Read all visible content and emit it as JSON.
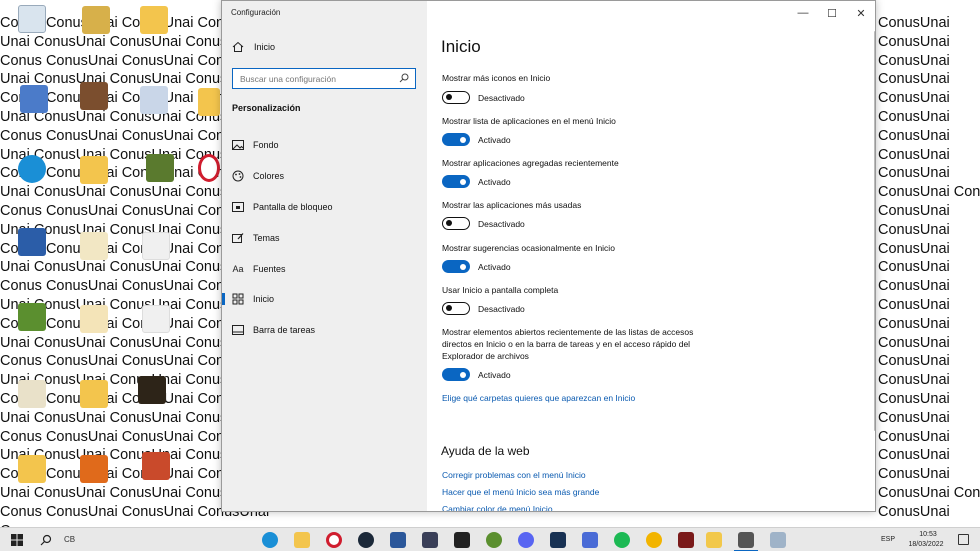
{
  "desktop": {
    "wallpaper_lines": [
      "Conus ConusUnai ConusUnai ConusUnai",
      "Unai ConusUnai ConusUnai ConusUnai",
      "Conus ConusUnai ConusUnai ConusUnai",
      "Unai ConusUnai ConusUnai ConusUnai",
      "Conus ConusUnai ConusUnai ConusUnai",
      "Unai ConusUnai ConusUnai ConusUnai",
      "Conus ConusUnai ConusUnai ConusUnai",
      "Unai ConusUnai ConusUnai ConusUnai",
      "Conus ConusUnai ConusUnai ConusUnai",
      "Unai ConusUnai ConusUnai ConusUnai",
      "Conus ConusUnai ConusUnai ConusUna",
      "Unai ConusUnai ConusUnai ConusUnai",
      "Conus ConusUnai ConusUnai ConusUnai",
      "Unai ConusUnai ConusUnai ConusUnai",
      "Conus ConusUnai ConusUnai ConusUnai",
      "Unai ConusUnai ConusUnai ConusUnai",
      "Conus ConusUnai ConusUnai ConusUnai",
      "Unai ConusUnai ConusUnai ConusUnai",
      "Conus ConusUnai ConusUnai ConusUnai",
      "Unai ConusUnai ConusUnai ConusUnai",
      "Conus ConusUnai ConusUnai ConusUnai",
      "Unai ConusUnai ConusUnai ConusUnai",
      "Conus ConusUnai ConusUnai ConusUnai",
      "Unai ConusUnai ConusUnai ConusUnai",
      "Conus ConusUnai ConusUnai ConusUnai",
      "Unai ConusUnai ConusUnai ConusUnai",
      "Conus ConusUnai ConusUnai ConusUnai",
      "Conus"
    ],
    "wallpaper_right_lines": [
      "ConusUnai",
      "ConusUnai",
      "ConusUnai",
      "ConusUnai",
      "ConusUnai",
      "ConusUnai",
      "ConusUnai",
      "ConusUnai",
      "ConusUnai",
      "ConusUnai Conus",
      "ConusUnai",
      "ConusUnai",
      "ConusUnai",
      "ConusUnai",
      "ConusUnai",
      "ConusUnai",
      "ConusUnai",
      "ConusUnai",
      "ConusUnai",
      "ConusUnai",
      "ConusUnai",
      "ConusUnai",
      "ConusUnai",
      "ConusUnai",
      "ConusUnai",
      "ConusUnai Conus",
      "ConusUnai"
    ]
  },
  "window": {
    "title": "Configuración",
    "controls": {
      "minimize": "—",
      "maximize": "☐",
      "close": "✕"
    }
  },
  "sidebar": {
    "home_label": "Inicio",
    "search_placeholder": "Buscar una configuración",
    "section_title": "Personalización",
    "items": [
      {
        "label": "Fondo",
        "icon": "image-icon"
      },
      {
        "label": "Colores",
        "icon": "palette-icon"
      },
      {
        "label": "Pantalla de bloqueo",
        "icon": "lock-screen-icon"
      },
      {
        "label": "Temas",
        "icon": "brush-icon"
      },
      {
        "label": "Fuentes",
        "icon": "font-icon"
      },
      {
        "label": "Inicio",
        "icon": "start-icon"
      },
      {
        "label": "Barra de tareas",
        "icon": "taskbar-icon"
      }
    ],
    "active_item": "Inicio"
  },
  "main": {
    "title": "Inicio",
    "settings": [
      {
        "label": "Mostrar más iconos en Inicio",
        "state": "Desactivado",
        "on": false
      },
      {
        "label": "Mostrar lista de aplicaciones en el menú Inicio",
        "state": "Activado",
        "on": true
      },
      {
        "label": "Mostrar aplicaciones agregadas recientemente",
        "state": "Activado",
        "on": true
      },
      {
        "label": "Mostrar las aplicaciones más usadas",
        "state": "Desactivado",
        "on": false
      },
      {
        "label": "Mostrar sugerencias ocasionalmente en Inicio",
        "state": "Activado",
        "on": true
      },
      {
        "label": "Usar Inicio a pantalla completa",
        "state": "Desactivado",
        "on": false
      },
      {
        "label": "Mostrar elementos abiertos recientemente de las listas de accesos directos en Inicio o en la barra de tareas y en el acceso rápido del Explorador de archivos",
        "state": "Activado",
        "on": true
      }
    ],
    "folders_link": "Elige qué carpetas quieres que aparezcan en Inicio",
    "help_title": "Ayuda de la web",
    "help_links": [
      "Corregir problemas con el menú Inicio",
      "Hacer que el menú Inicio sea más grande",
      "Cambiar color de menú Inicio"
    ]
  },
  "taskbar": {
    "search_text": "CB",
    "language": "ESP",
    "time": "10:53",
    "date": "18/03/2022",
    "accent_color": "#0a66c2"
  }
}
